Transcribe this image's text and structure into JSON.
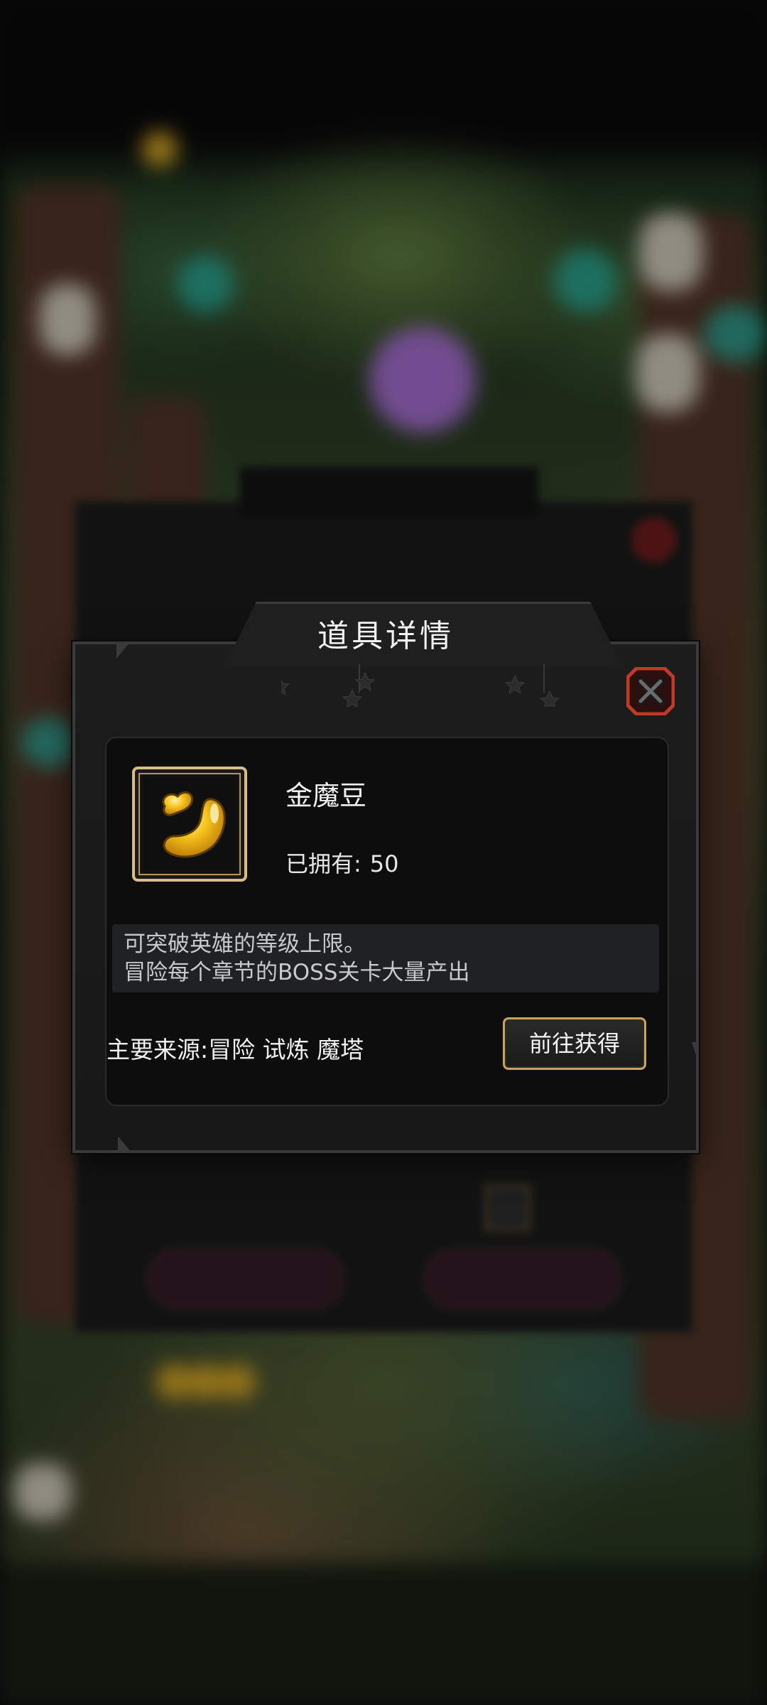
{
  "dialog": {
    "title": "道具详情",
    "item": {
      "name": "金魔豆",
      "owned_label": "已拥有:",
      "owned_count": "50",
      "icon": "golden-bean-icon"
    },
    "description": [
      "可突破英雄的等级上限。",
      "冒险每个章节的BOSS关卡大量产出"
    ],
    "source_text": "主要来源:冒险 试炼 魔塔",
    "goto_button": "前往获得",
    "close_icon": "close-x-icon"
  },
  "colors": {
    "accent_gold": "#caa35d",
    "close_red": "#c0392b",
    "panel_bg": "#0d0d0d"
  }
}
